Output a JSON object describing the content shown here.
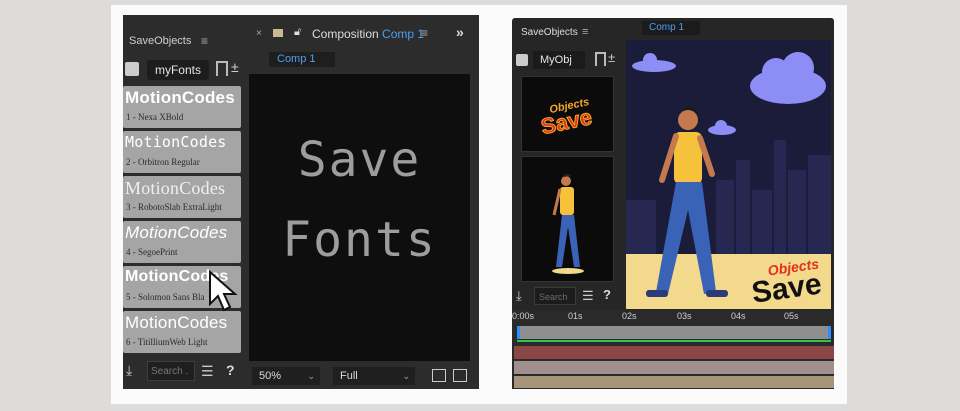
{
  "left_panel": {
    "title": "SaveObjects",
    "menu": "≡",
    "preset": "myFonts",
    "fonts": [
      {
        "name": "MotionCodes",
        "caption": "1 - Nexa XBold"
      },
      {
        "name": "MotionCodes",
        "caption": "2 - Orbitron Regular"
      },
      {
        "name": "MotionCodes",
        "caption": "3 - RobotoSlab ExtraLight"
      },
      {
        "name": "MotionCodes",
        "caption": "4 - SegoePrint"
      },
      {
        "name": "MotionCodes",
        "caption": "5 - Solomon Sans Bla"
      },
      {
        "name": "MotionCodes",
        "caption": "6 - TitilliumWeb Light"
      }
    ],
    "search_placeholder": "Search .",
    "help": "?"
  },
  "composition": {
    "close": "×",
    "label": "Composition",
    "comp_name": "Comp 1",
    "menu": "≡",
    "expand": "»",
    "tab": "Comp 1",
    "viewer_text_line1": "Save",
    "viewer_text_line2": "Fonts",
    "zoom": "50%",
    "resolution": "Full"
  },
  "right_panel": {
    "title": "SaveObjects",
    "menu": "≡",
    "tab": "Comp 1",
    "preset": "MyObj",
    "thumb_text_top": "Objects",
    "thumb_text_bottom": "Save",
    "search_placeholder": "Search",
    "help": "?",
    "scene_text_top": "Objects",
    "scene_text_bottom": "Save",
    "timeline_ticks": [
      "0:00s",
      "01s",
      "02s",
      "03s",
      "04s",
      "05s"
    ]
  },
  "colors": {
    "accent_blue": "#4d9ff2",
    "scene_bg": "#1b1c3a",
    "scene_floor": "#f3d98b",
    "text_red": "#e0321e",
    "text_orange": "#f5a623"
  }
}
